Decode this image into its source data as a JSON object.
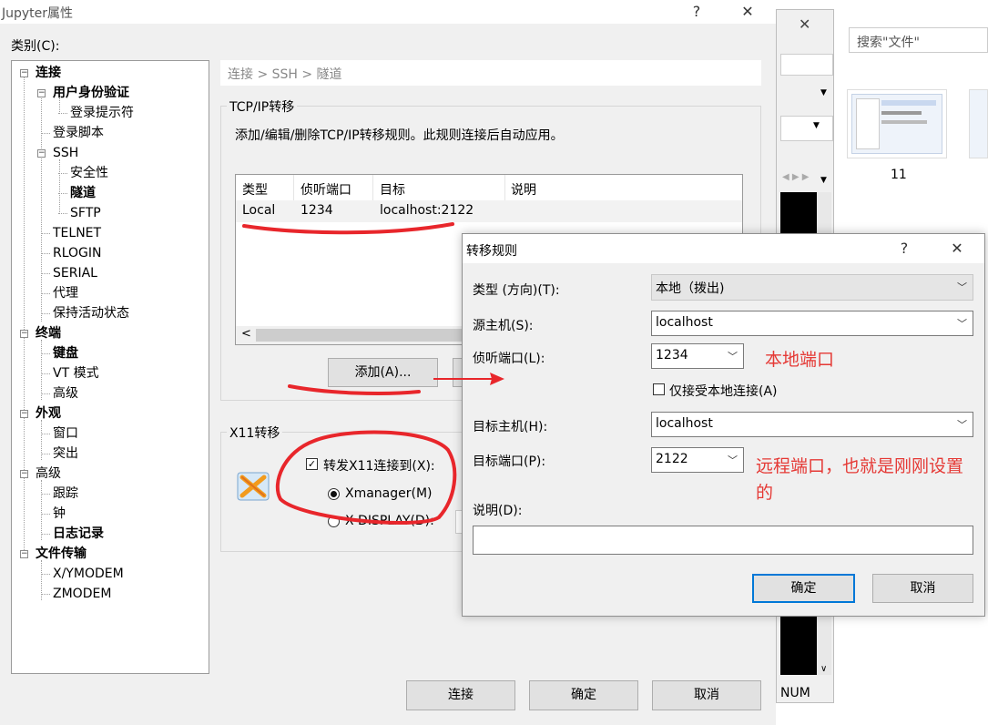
{
  "main_dialog": {
    "title": "Jupyter属性",
    "help": "?",
    "close": "✕",
    "category_label": "类别(C):",
    "breadcrumb": "连接 > SSH > 隧道",
    "tcp_group": "TCP/IP转移",
    "tcp_desc": "添加/编辑/删除TCP/IP转移规则。此规则连接后自动应用。",
    "columns": [
      "类型",
      "侦听端口",
      "目标",
      "说明"
    ],
    "rows": [
      {
        "type": "Local",
        "port": "1234",
        "target": "localhost:2122",
        "desc": ""
      }
    ],
    "scroll_left": "<",
    "add_button": "添加(A)...",
    "x11_group": "X11转移",
    "x11_forward": "转发X11连接到(X):",
    "xmanager": "Xmanager(M)",
    "xdisplay": "X DISPLAY(D):",
    "footer": {
      "connect": "连接",
      "ok": "确定",
      "cancel": "取消"
    }
  },
  "tree": [
    {
      "label": "连接",
      "bold": true
    },
    {
      "label": "用户身份验证",
      "bold": true
    },
    {
      "label": "登录提示符",
      "bold": false
    },
    {
      "label": "登录脚本",
      "bold": false
    },
    {
      "label": "SSH",
      "bold": false
    },
    {
      "label": "安全性",
      "bold": false
    },
    {
      "label": "隧道",
      "bold": true
    },
    {
      "label": "SFTP",
      "bold": false
    },
    {
      "label": "TELNET",
      "bold": false
    },
    {
      "label": "RLOGIN",
      "bold": false
    },
    {
      "label": "SERIAL",
      "bold": false
    },
    {
      "label": "代理",
      "bold": false
    },
    {
      "label": "保持活动状态",
      "bold": false
    },
    {
      "label": "终端",
      "bold": true
    },
    {
      "label": "键盘",
      "bold": true
    },
    {
      "label": "VT 模式",
      "bold": false
    },
    {
      "label": "高级",
      "bold": false
    },
    {
      "label": "外观",
      "bold": true
    },
    {
      "label": "窗口",
      "bold": false
    },
    {
      "label": "突出",
      "bold": false
    },
    {
      "label": "高级",
      "bold": false
    },
    {
      "label": "跟踪",
      "bold": false
    },
    {
      "label": "钟",
      "bold": false
    },
    {
      "label": "日志记录",
      "bold": true
    },
    {
      "label": "文件传输",
      "bold": true
    },
    {
      "label": "X/YMODEM",
      "bold": false
    },
    {
      "label": "ZMODEM",
      "bold": false
    }
  ],
  "rule_dialog": {
    "title": "转移规则",
    "help": "?",
    "close": "✕",
    "type_label": "类型 (方向)(T):",
    "type_value": "本地（拨出)",
    "source_label": "源主机(S):",
    "source_value": "localhost",
    "listen_label": "侦听端口(L):",
    "listen_value": "1234",
    "local_only": "仅接受本地连接(A)",
    "dest_host_label": "目标主机(H):",
    "dest_host_value": "localhost",
    "dest_port_label": "目标端口(P):",
    "dest_port_value": "2122",
    "desc_label": "说明(D):",
    "desc_value": "",
    "ok": "确定",
    "cancel": "取消"
  },
  "annotations": {
    "local_port": "本地端口",
    "remote_port_line1": "远程端口，也就是刚刚设置",
    "remote_port_line2": "的"
  },
  "background": {
    "search_placeholder": "搜索\"文件\"",
    "file_label": "11",
    "status_num": "NUM",
    "close": "✕"
  },
  "colors": {
    "accent": "#0078d7",
    "annotation": "#e53935",
    "marker": "#e8262b"
  }
}
